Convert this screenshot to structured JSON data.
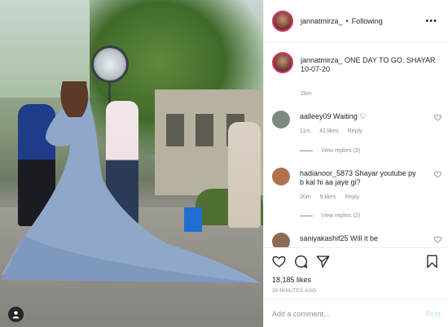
{
  "header": {
    "username": "jannatmirza_",
    "separator": "•",
    "follow_status": "Following",
    "more_glyph": "•••"
  },
  "caption": {
    "text": "jannatmirza_ ONE DAY TO GO. SHAYAR 10-07-20",
    "time": "28m"
  },
  "comments": [
    {
      "text": "aalleey09 Waiting ♡",
      "time": "11m",
      "likes": "41 likes",
      "reply": "Reply",
      "view_replies": "View replies (3)",
      "avatar_color": "#7d8a80"
    },
    {
      "text": "hadianoor_5873 Shayar youtube py b kal hi aa jaye gi?",
      "time": "20m",
      "likes": "9 likes",
      "reply": "Reply",
      "view_replies": "View replies (2)",
      "avatar_color": "#b0724a"
    },
    {
      "text": "saniyakashif25 Will it be",
      "avatar_color": "#8c6b52"
    }
  ],
  "actions": {
    "likes": "18,185 likes",
    "time_ago": "28 MINUTES AGO"
  },
  "add_comment": {
    "placeholder": "Add a comment...",
    "post_label": "Post"
  },
  "colors": {
    "story_ring": "#e1306c",
    "post_disabled": "#b2dffc",
    "secondary_text": "#8e8e8e"
  }
}
